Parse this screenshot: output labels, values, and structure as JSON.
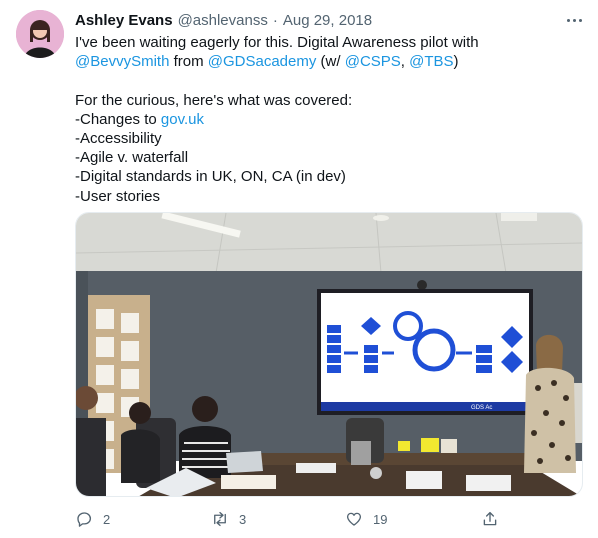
{
  "tweet": {
    "display_name": "Ashley Evans",
    "handle": "@ashlevanss",
    "separator": "·",
    "date": "Aug 29, 2018",
    "text": {
      "l1": "I've been waiting eagerly for this. Digital Awareness pilot with",
      "mention_bevvy": "@BevvySmith",
      "from": " from ",
      "mention_gds": "@GDSacademy",
      "w": " (w/ ",
      "mention_csps": "@CSPS",
      "comma": ", ",
      "mention_tbs": "@TBS",
      "close": ")",
      "curious": "For the curious, here's what was covered:",
      "changes_prefix": "-Changes to ",
      "govuk_link": "gov.uk",
      "accessibility": "-Accessibility",
      "agile": "-Agile v. waterfall",
      "standards": "-Digital standards in UK, ON, CA (in dev)",
      "stories": "-User stories"
    },
    "photo": {
      "screen_footer": "GDS Ac"
    },
    "actions": {
      "reply_count": "2",
      "retweet_count": "3",
      "like_count": "19"
    }
  }
}
